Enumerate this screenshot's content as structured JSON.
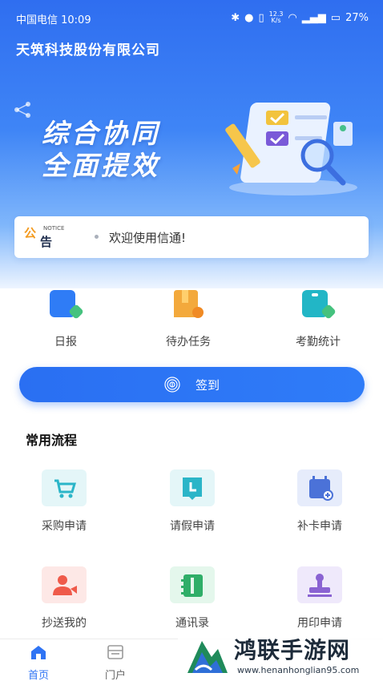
{
  "status_bar": {
    "carrier_time": "中国电信 10:09",
    "net_speed_value": "12.3",
    "net_speed_unit": "K/s",
    "battery": "27%"
  },
  "header": {
    "company": "天筑科技股份有限公司"
  },
  "banner": {
    "line1": "综合协同",
    "line2": "全面提效"
  },
  "notice": {
    "badge_top": "公",
    "badge_bottom": "告",
    "badge_en": "NOTICE",
    "text": "欢迎使用信通!"
  },
  "quick_actions": [
    {
      "label": "日报"
    },
    {
      "label": "待办任务"
    },
    {
      "label": "考勤统计"
    }
  ],
  "signin": {
    "label": "签到"
  },
  "section": {
    "title": "常用流程"
  },
  "flows": [
    {
      "label": "采购申请"
    },
    {
      "label": "请假申请"
    },
    {
      "label": "补卡申请"
    },
    {
      "label": "抄送我的"
    },
    {
      "label": "通讯录"
    },
    {
      "label": "用印申请"
    }
  ],
  "tabbar": [
    {
      "label": "首页",
      "active": true
    },
    {
      "label": "门户",
      "active": false
    }
  ],
  "watermark": {
    "name": "鸿联手游网",
    "url": "www.henanhonglian95.com"
  },
  "colors": {
    "primary": "#2f74f4",
    "accent_orange": "#f39a1e",
    "teal": "#2bb5c8"
  }
}
